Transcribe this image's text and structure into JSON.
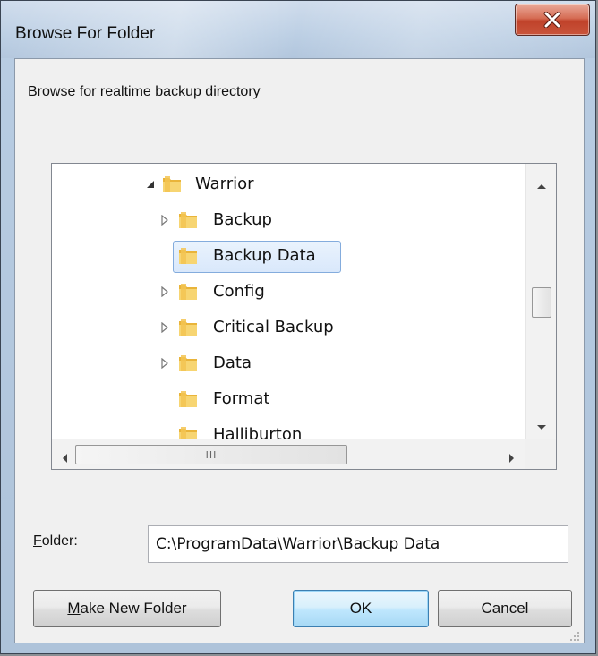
{
  "window": {
    "title": "Browse For Folder"
  },
  "dialog": {
    "description": "Browse for realtime backup directory"
  },
  "tree": {
    "items": [
      {
        "label": "Warrior",
        "expander": "expanded",
        "selected": false
      },
      {
        "label": "Backup",
        "expander": "collapsed",
        "selected": false
      },
      {
        "label": "Backup Data",
        "expander": "none",
        "selected": true
      },
      {
        "label": "Config",
        "expander": "collapsed",
        "selected": false
      },
      {
        "label": "Critical Backup",
        "expander": "collapsed",
        "selected": false
      },
      {
        "label": "Data",
        "expander": "collapsed",
        "selected": false
      },
      {
        "label": "Format",
        "expander": "none",
        "selected": false
      },
      {
        "label": "Halliburton",
        "expander": "none",
        "selected": false
      }
    ],
    "scroll_grip_label": "III"
  },
  "folder": {
    "label_prefix": "",
    "label_mnemonic": "F",
    "label_rest": "older:",
    "value": "C:\\ProgramData\\Warrior\\Backup Data"
  },
  "buttons": {
    "make_new_mnemonic": "M",
    "make_new_rest": "ake New Folder",
    "ok": "OK",
    "cancel": "Cancel"
  },
  "colors": {
    "close_button": "#c9553c",
    "selection_border": "#84acdd",
    "folder_yellow": "#f5c84a"
  },
  "icons": {
    "close": "close-icon",
    "folder": "folder-icon",
    "expanded": "expanded-triangle-icon",
    "collapsed": "collapsed-triangle-icon"
  }
}
